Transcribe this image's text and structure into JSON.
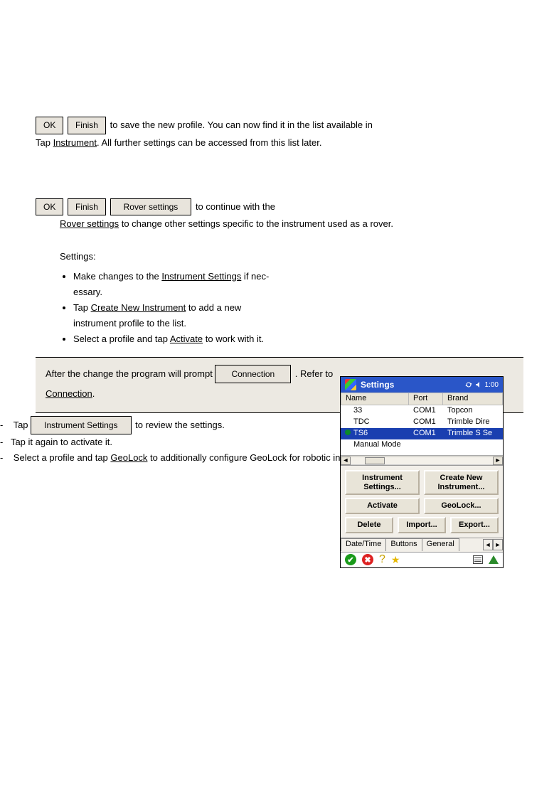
{
  "row1": {
    "ok_btn": "OK",
    "finish_btn": "Finish",
    "text": " to save the new profile. You can now find it in the list available in"
  },
  "instr_link": "Instrument",
  "instr_after": ". All further settings can be accessed from this list later.",
  "row2": {
    "ok_btn": "OK",
    "finish_btn": "Finish",
    "rover_btn": "Rover settings",
    "text": " to continue with the"
  },
  "rover_link": "Rover settings",
  "rover_after": " to change other settings specific to the instrument used as a rover.",
  "list": {
    "settings_label": "Settings:",
    "i1a": "Make changes to the ",
    "i1b": "Instrument Settings",
    "i1c": " if nec-essary.",
    "i2a": "Tap ",
    "i2b": "Create New Instrument",
    "i2c": " to add a new instrument profile to the list.",
    "i3a": "Select a profile and tap ",
    "i3b": "Activate",
    "i3c": " to work with it."
  },
  "note": {
    "lead": "After the change the program will prompt ",
    "btn_label": "Connection",
    "tail": ". Refer to ",
    "link": "Connection",
    "after_link": ".",
    "t1": "Tap ",
    "t1_btn": "Instrument Settings",
    "t1_tail": " to review the settings.",
    "t2": "Tap it again to activate it.",
    "t3a": "Select a profile and tap ",
    "t3_link": "GeoLock",
    "t3b": " to additionally configure GeoLock for robotic instruments."
  },
  "pda": {
    "title": "Settings",
    "time": "1:00",
    "headers": {
      "name": "Name",
      "port": "Port",
      "brand": "Brand"
    },
    "rows": [
      {
        "name": "33",
        "port": "COM1",
        "brand": "Topcon",
        "active": false
      },
      {
        "name": "TDC",
        "port": "COM1",
        "brand": "Trimble Dire",
        "active": false
      },
      {
        "name": "TS6",
        "port": "COM1",
        "brand": "Trimble S Se",
        "active": true
      },
      {
        "name": "Manual Mode",
        "port": "",
        "brand": "",
        "active": false
      }
    ],
    "buttons": {
      "instr_settings": "Instrument Settings...",
      "create_new": "Create New Instrument...",
      "activate": "Activate",
      "geolock": "GeoLock...",
      "delete": "Delete",
      "import": "Import...",
      "export": "Export..."
    },
    "tabs": {
      "t1": "Date/Time",
      "t2": "Buttons",
      "t3": "General"
    }
  }
}
